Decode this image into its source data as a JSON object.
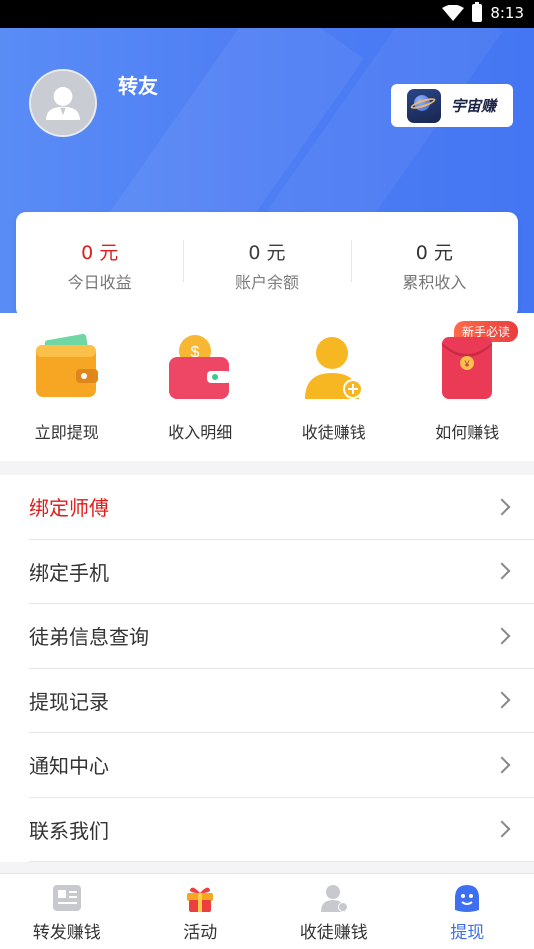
{
  "status_bar": {
    "time": "8:13"
  },
  "profile": {
    "username": "转友",
    "app_badge": "宇宙赚"
  },
  "stats": [
    {
      "value": "0 元",
      "label": "今日收益"
    },
    {
      "value": "0 元",
      "label": "账户余额"
    },
    {
      "value": "0 元",
      "label": "累积收入"
    }
  ],
  "quick_actions": [
    {
      "label": "立即提现",
      "icon": "wallet-icon"
    },
    {
      "label": "收入明细",
      "icon": "purse-coin-icon"
    },
    {
      "label": "收徒赚钱",
      "icon": "add-user-icon"
    },
    {
      "label": "如何赚钱",
      "icon": "red-envelope-icon",
      "tag": "新手必读"
    }
  ],
  "menu": [
    {
      "label": "绑定师傅",
      "highlight": true
    },
    {
      "label": "绑定手机"
    },
    {
      "label": "徒弟信息查询"
    },
    {
      "label": "提现记录"
    },
    {
      "label": "通知中心"
    },
    {
      "label": "联系我们"
    }
  ],
  "bottom_nav": [
    {
      "label": "转发赚钱",
      "icon": "news-icon"
    },
    {
      "label": "活动",
      "icon": "gift-icon"
    },
    {
      "label": "收徒赚钱",
      "icon": "user-icon"
    },
    {
      "label": "提现",
      "icon": "smile-face-icon",
      "active": true
    }
  ],
  "colors": {
    "header": "#4f7ff4",
    "accent": "#3d6ff0",
    "highlight": "#e11b1b"
  }
}
